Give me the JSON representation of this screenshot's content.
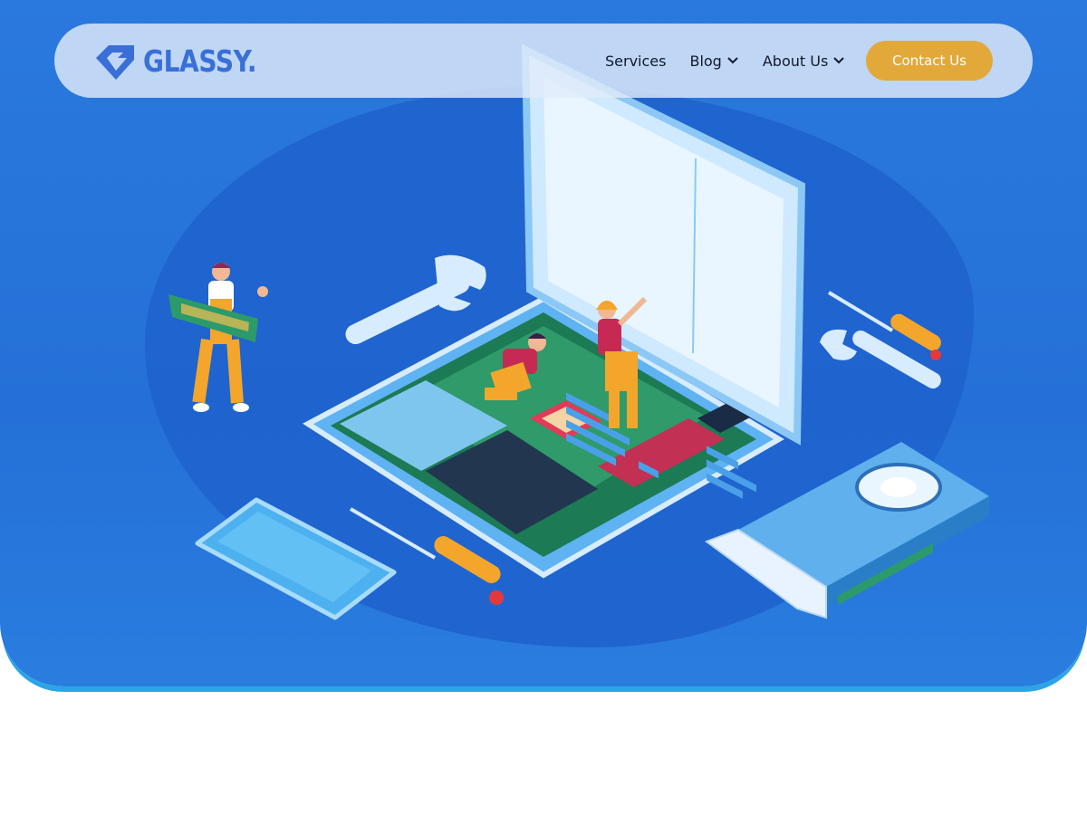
{
  "brand": {
    "name": "GLASSY.",
    "logo_icon": "glassy-diamond-logo-icon"
  },
  "nav": {
    "items": [
      {
        "label": "Services",
        "has_dropdown": false
      },
      {
        "label": "Blog",
        "has_dropdown": true
      },
      {
        "label": "About Us",
        "has_dropdown": true
      }
    ],
    "cta_label": "Contact Us"
  },
  "colors": {
    "hero_background": "#2a79de",
    "accent": "#e2a93a",
    "brand": "#3a6fd8",
    "nav_text": "#121a2c"
  },
  "hero_image": "computer-repair-illustration"
}
